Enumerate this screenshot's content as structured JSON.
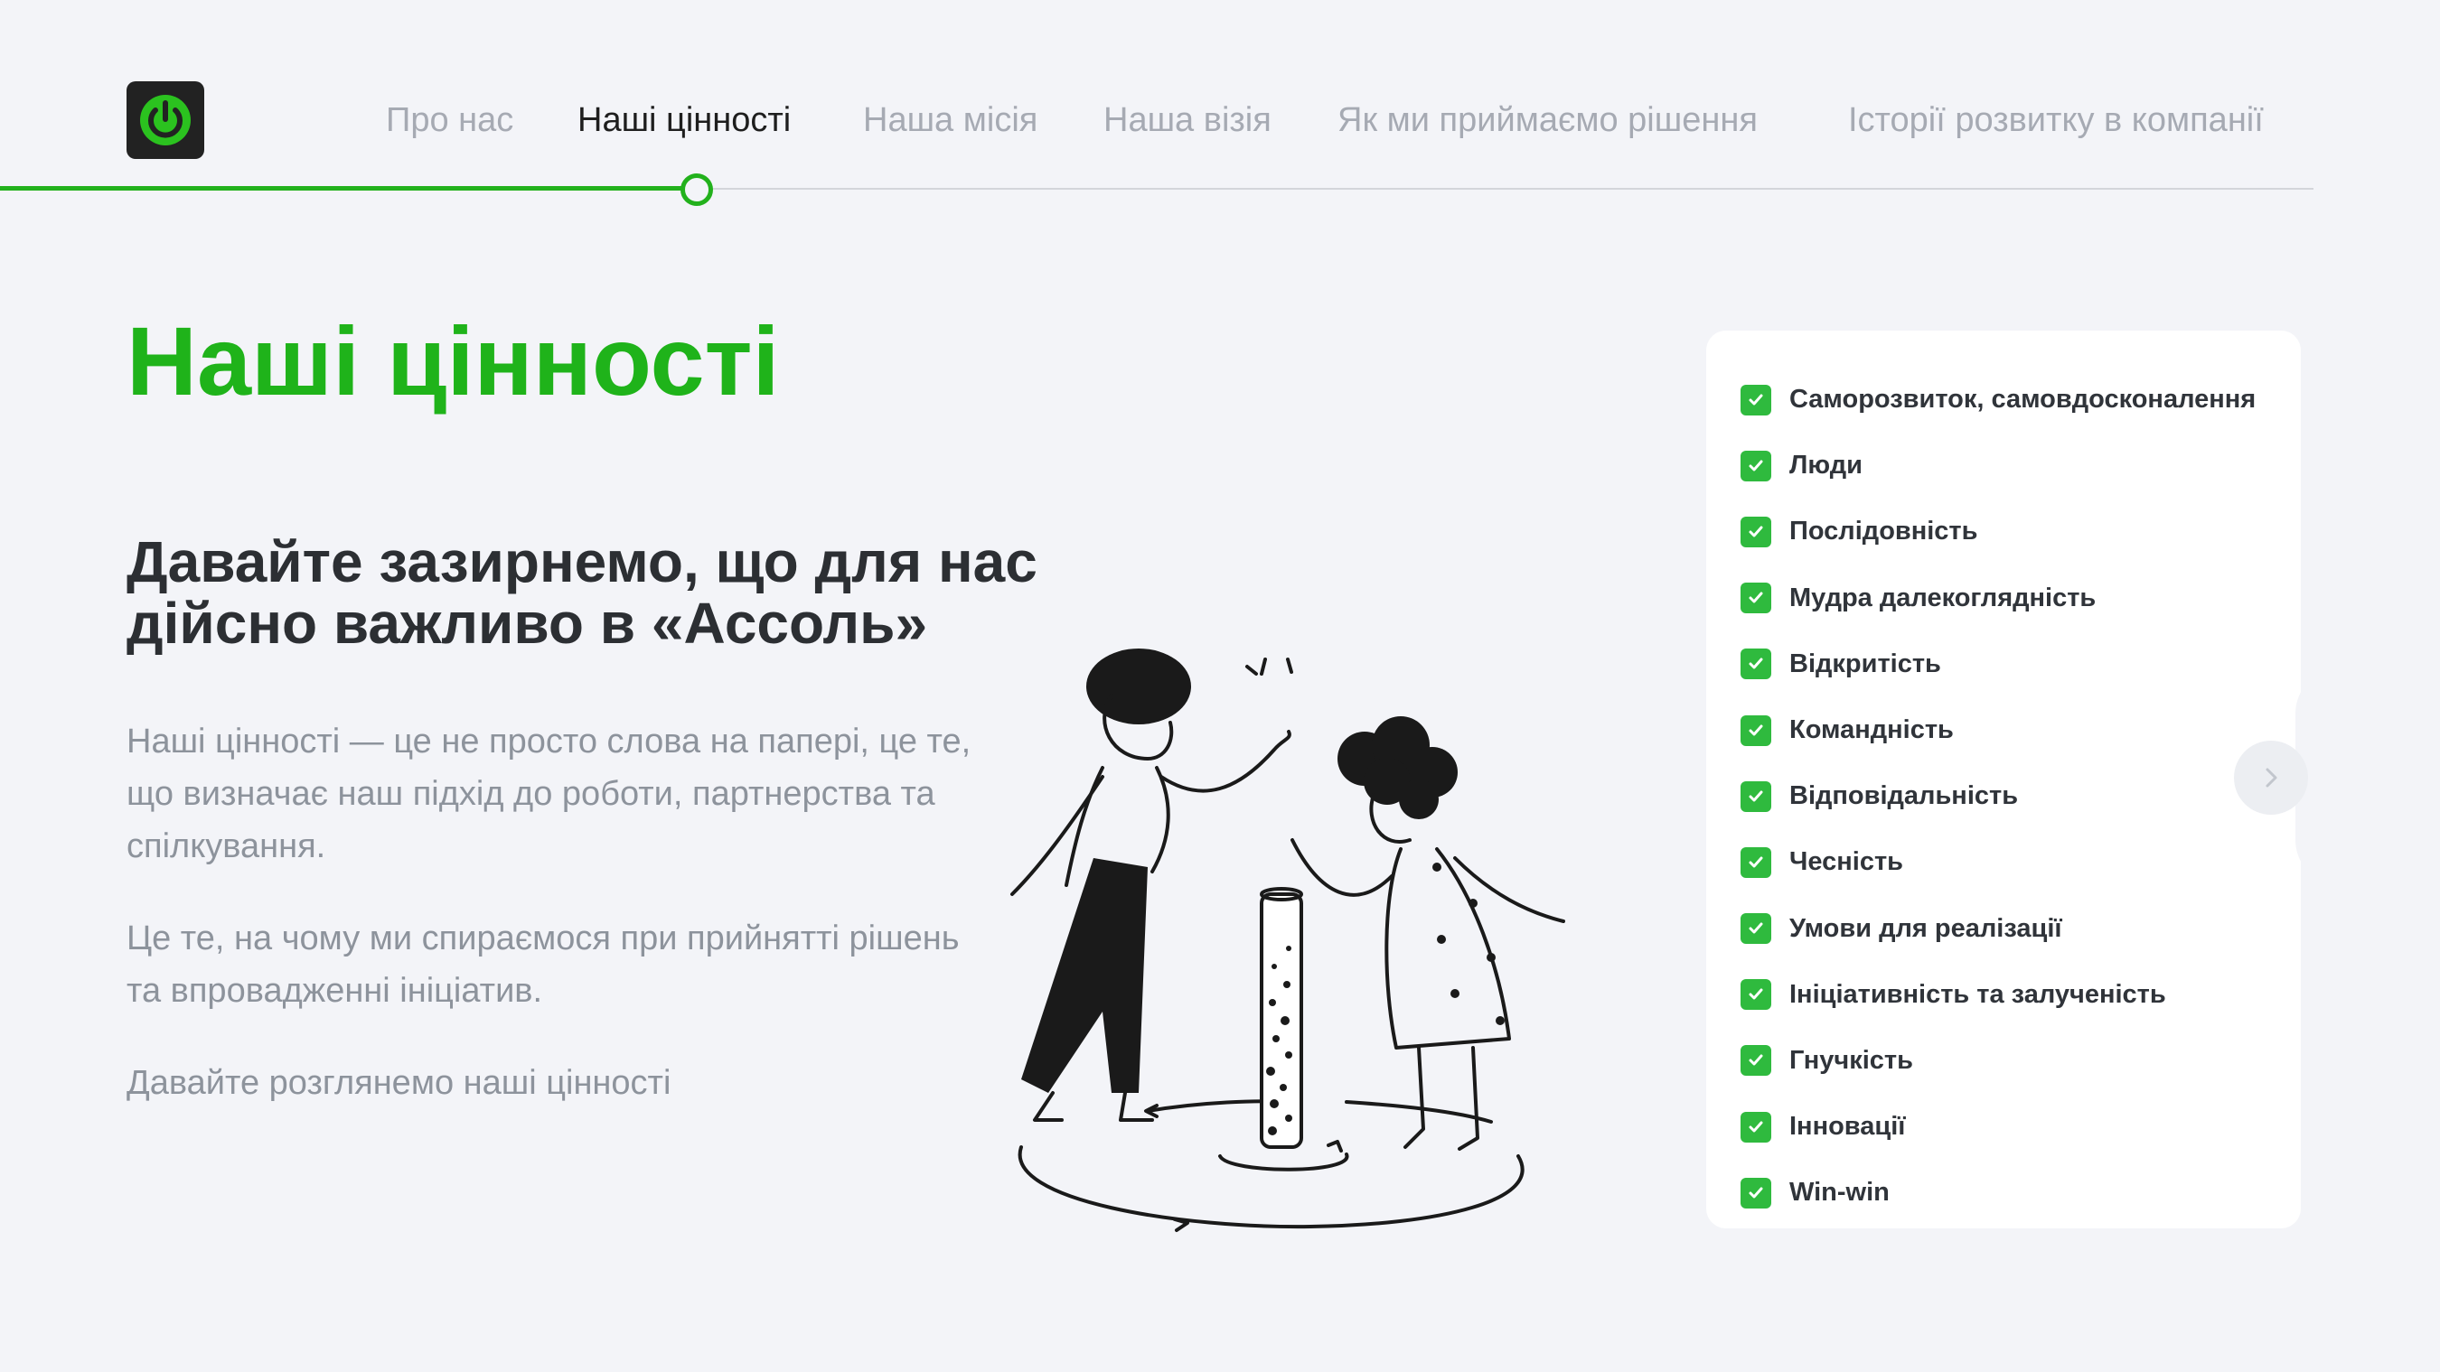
{
  "nav": {
    "items": [
      {
        "label": "Про нас",
        "active": false
      },
      {
        "label": "Наші цінності",
        "active": true
      },
      {
        "label": "Наша місія",
        "active": false
      },
      {
        "label": "Наша візія",
        "active": false
      },
      {
        "label": "Як ми приймаємо рішення",
        "active": false
      },
      {
        "label": "Історії розвитку в компанії",
        "active": false
      }
    ]
  },
  "progress": {
    "current_step": 2,
    "total_steps": 6
  },
  "main": {
    "title": "Наші цінності",
    "subtitle": "Давайте зазирнемо, що для нас дійсно важливо в «Ассоль»",
    "paragraphs": [
      "Наші цінності — це не просто слова на папері, це те, що визначає наш підхід до роботи, партнерства та спілкування.",
      "Це те, на чому ми спираємося при прийнятті рішень та впровадженні ініціатив.",
      "Давайте розглянемо наші цінності"
    ]
  },
  "values": [
    "Саморозвиток, самовдосконалення",
    "Люди",
    "Послідовність",
    "Мудра далекоглядність",
    "Відкритість",
    "Командність",
    "Відповідальність",
    "Чесність",
    "Умови для реалізації",
    "Ініціативність та залученість",
    "Гнучкість",
    "Інновації",
    "Win-win"
  ],
  "icons": {
    "logo": "power-icon",
    "check": "checkmark-icon",
    "next": "chevron-right-icon"
  },
  "colors": {
    "accent": "#22b11c",
    "check": "#2fba3e",
    "background": "#f3f4f8",
    "logo_bg": "#222222"
  }
}
